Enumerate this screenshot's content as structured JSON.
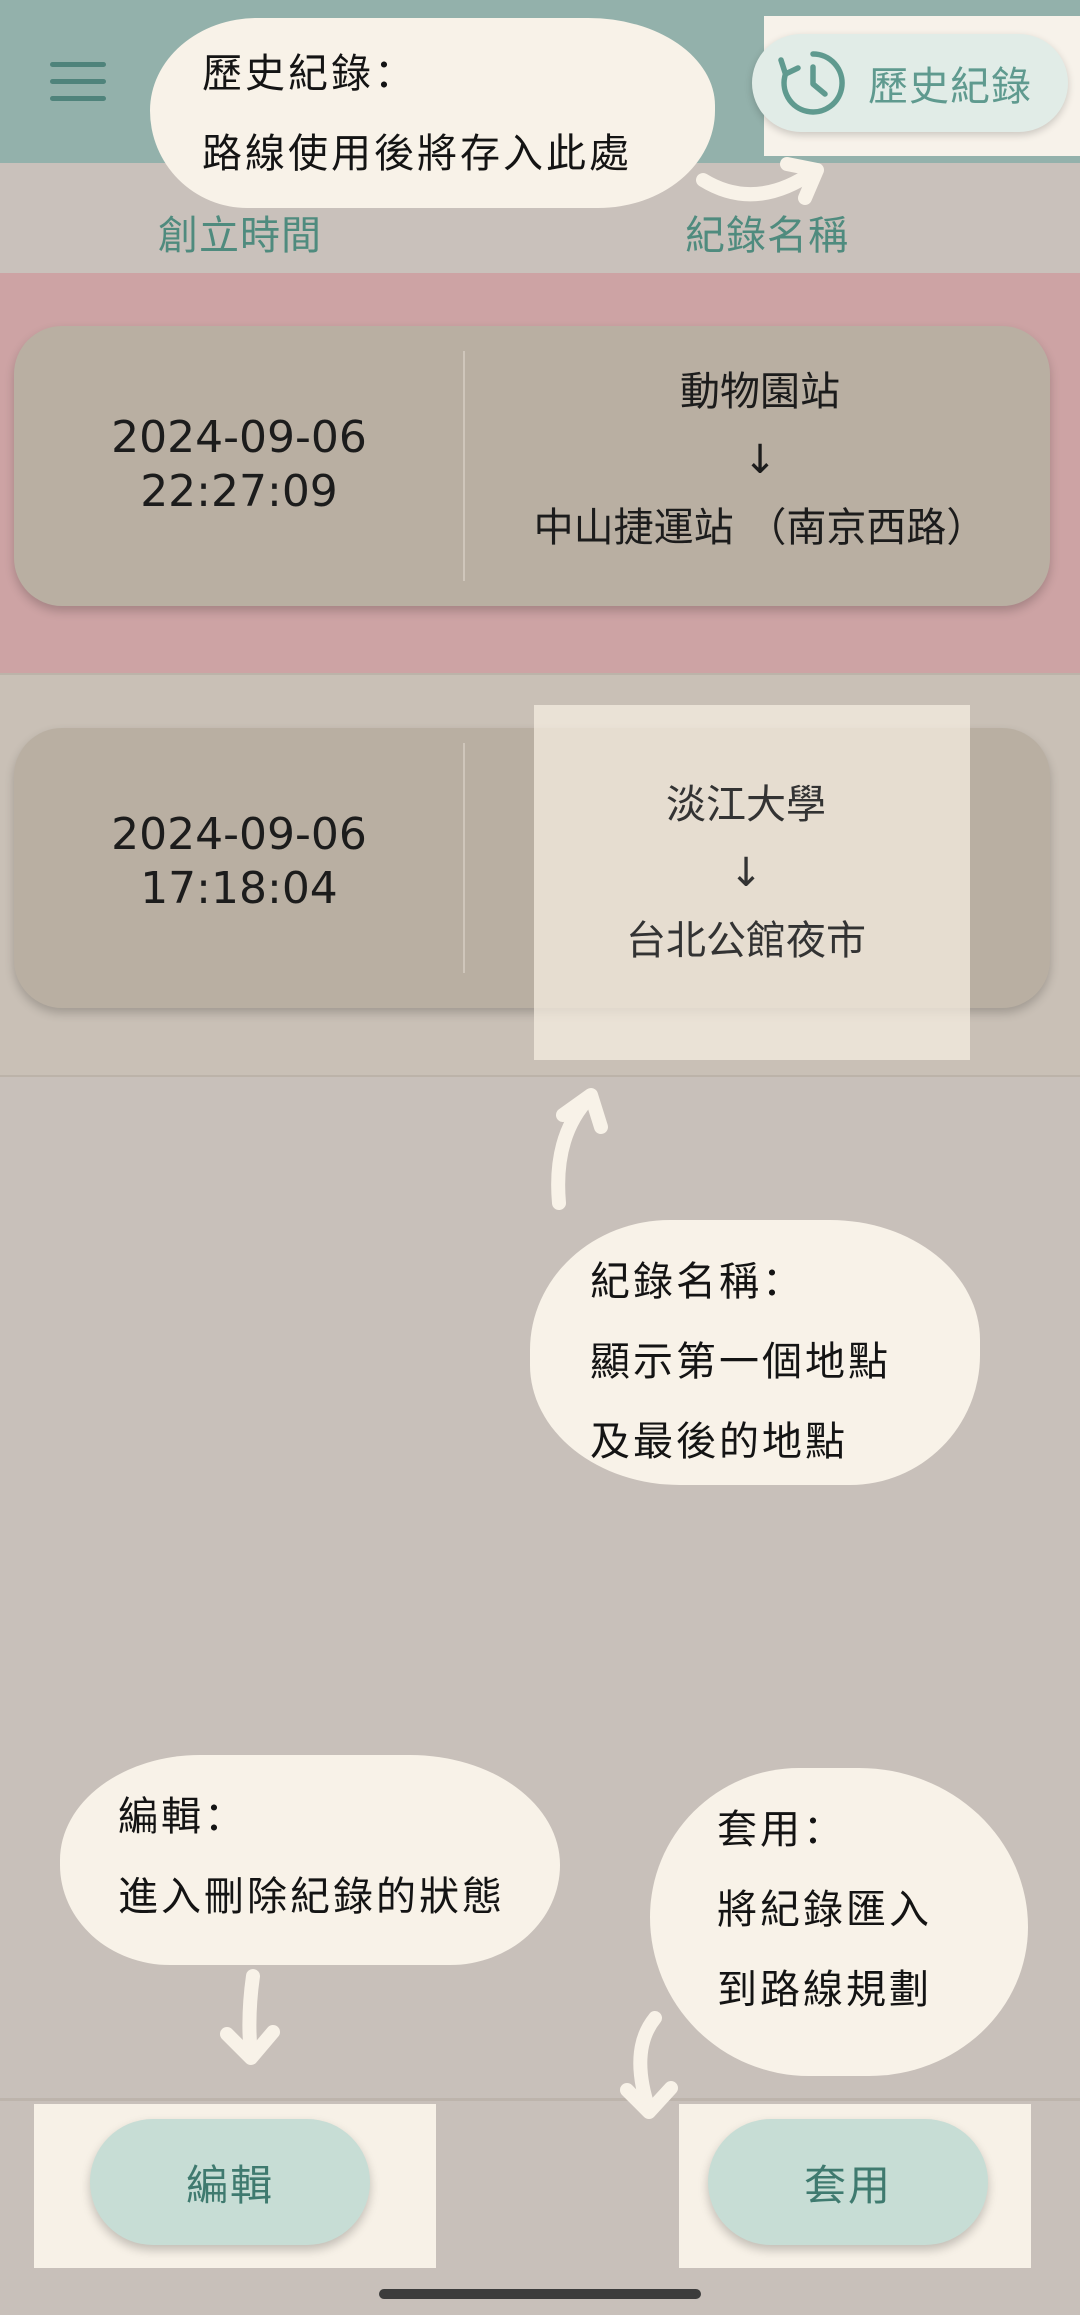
{
  "app_bar": {
    "history_button_label": "歷史紀錄",
    "menu_icon": "hamburger-menu-icon",
    "history_icon": "history-clock-icon"
  },
  "columns": {
    "created_time": "創立時間",
    "record_name": "紀錄名稱"
  },
  "records": [
    {
      "date": "2024-09-06",
      "time": "22:27:09",
      "start": "動物園站",
      "arrow": "↓",
      "end": "中山捷運站 （南京西路）",
      "selected": true
    },
    {
      "date": "2024-09-06",
      "time": "17:18:04",
      "start": "淡江大學",
      "arrow": "↓",
      "end": "台北公館夜市",
      "selected": false
    }
  ],
  "bottom_bar": {
    "edit_label": "編輯",
    "apply_label": "套用"
  },
  "annotations": {
    "history": {
      "title": "歷史紀錄：",
      "line1": "路線使用後將存入此處"
    },
    "record_name": {
      "title": "紀錄名稱：",
      "line1": "顯示第一個地點",
      "line2": "及最後的地點"
    },
    "edit": {
      "title": "編輯：",
      "line1": "進入刪除紀錄的狀態"
    },
    "apply": {
      "title": "套用：",
      "line1": "將紀錄匯入",
      "line2": "到路線規劃"
    }
  },
  "colors": {
    "app_bar": "#93b1ab",
    "accent": "#4f8b7e",
    "selected_row": "#cda3a4",
    "card": "#b9afa2",
    "callout": "#f8f2e8",
    "button": "#c7ddd5"
  }
}
